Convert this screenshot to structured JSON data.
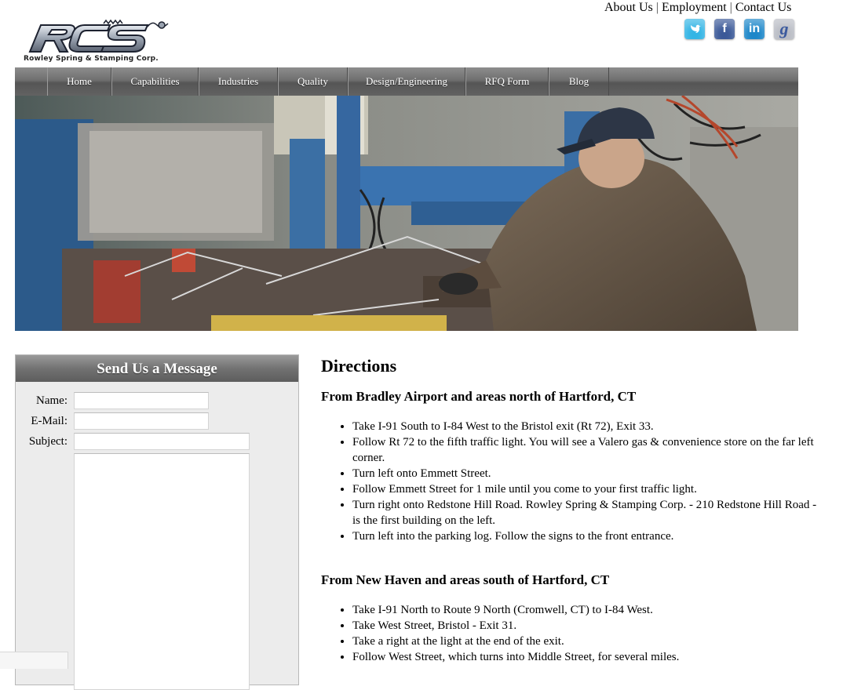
{
  "top_links": [
    "About Us",
    "Employment",
    "Contact Us"
  ],
  "social": [
    "twitter-icon",
    "facebook-icon",
    "linkedin-icon",
    "google-icon"
  ],
  "logo": {
    "mark": "RCS",
    "company": "Rowley Spring & Stamping Corp."
  },
  "nav": [
    "Home",
    "Capabilities",
    "Industries",
    "Quality",
    "Design/Engineering",
    "RFQ Form",
    "Blog"
  ],
  "message": {
    "title": "Send Us a Message",
    "name_label": "Name:",
    "email_label": "E-Mail:",
    "subject_label": "Subject:"
  },
  "directions": {
    "title": "Directions",
    "sections": [
      {
        "heading": "From Bradley Airport and areas north of Hartford, CT",
        "steps": [
          "Take I-91 South to I-84 West to the Bristol exit (Rt 72), Exit 33.",
          "Follow Rt 72 to the fifth traffic light. You will see a Valero gas & convenience store on the far left corner.",
          "Turn left onto Emmett Street.",
          "Follow Emmett Street for 1 mile until you come to your first traffic light.",
          "Turn right onto Redstone Hill Road. Rowley Spring & Stamping Corp. - 210 Redstone Hill Road - is the first building on the left.",
          "Turn left into the parking log. Follow the signs to the front entrance."
        ]
      },
      {
        "heading": "From New Haven and areas south of Hartford, CT",
        "steps": [
          "Take I-91 North to Route 9 North (Cromwell, CT) to I-84 West.",
          "Take West Street, Bristol - Exit 31.",
          "Take a right at the light at the end of the exit.",
          "Follow West Street, which turns into Middle Street, for several miles."
        ]
      }
    ]
  }
}
